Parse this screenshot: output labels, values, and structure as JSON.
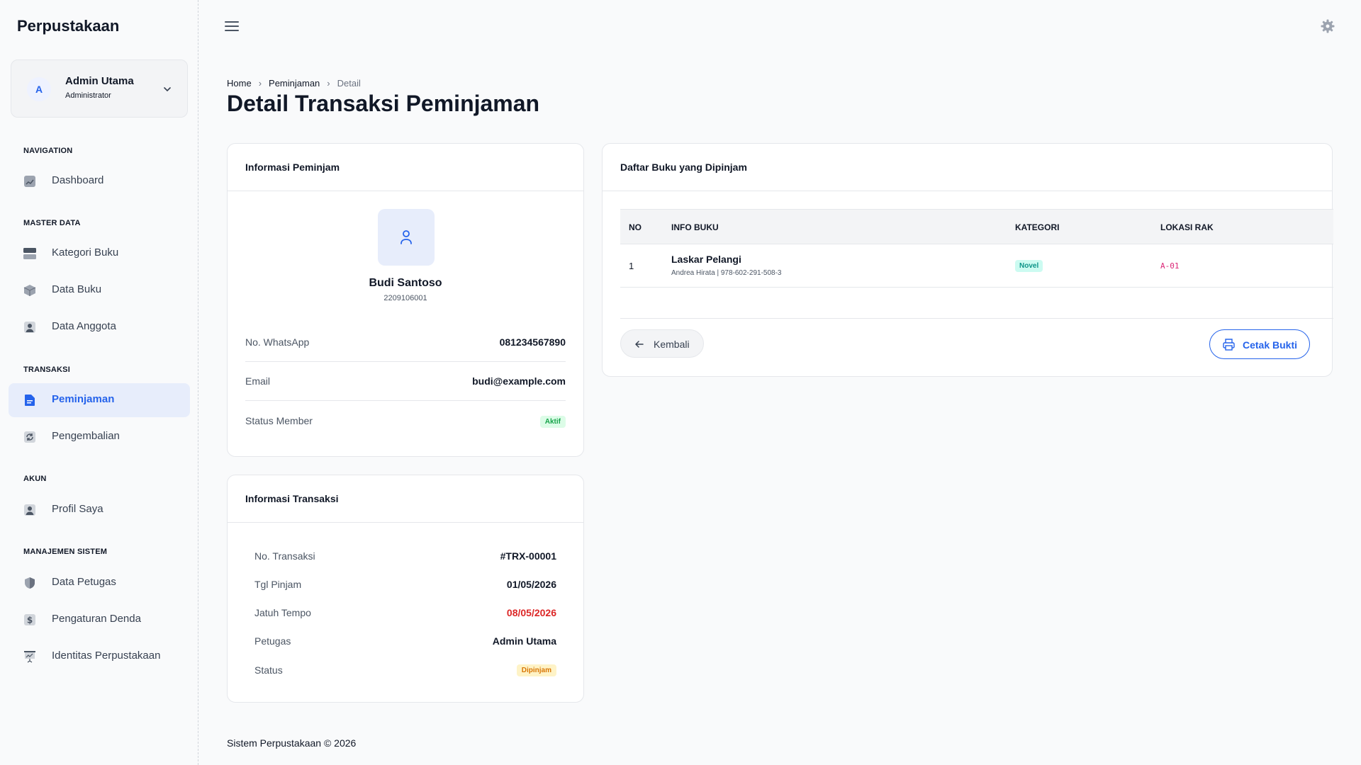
{
  "app": {
    "brand": "Perpustakaan"
  },
  "user": {
    "initial": "A",
    "name": "Admin Utama",
    "role": "Administrator"
  },
  "sidebar": {
    "sections": [
      {
        "title": "NAVIGATION"
      },
      {
        "title": "MASTER DATA"
      },
      {
        "title": "TRANSAKSI"
      },
      {
        "title": "AKUN"
      },
      {
        "title": "MANAJEMEN SISTEM"
      }
    ],
    "items": [
      {
        "label": "Dashboard",
        "icon": "chart-icon"
      },
      {
        "label": "Kategori Buku",
        "icon": "category-icon"
      },
      {
        "label": "Data Buku",
        "icon": "box-icon"
      },
      {
        "label": "Data Anggota",
        "icon": "user-icon"
      },
      {
        "label": "Peminjaman",
        "icon": "document-icon",
        "active": true
      },
      {
        "label": "Pengembalian",
        "icon": "refresh-icon"
      },
      {
        "label": "Profil Saya",
        "icon": "user-icon"
      },
      {
        "label": "Data Petugas",
        "icon": "shield-icon"
      },
      {
        "label": "Pengaturan Denda",
        "icon": "dollar-icon"
      },
      {
        "label": "Identitas Perpustakaan",
        "icon": "presentation-icon"
      }
    ]
  },
  "breadcrumb": [
    "Home",
    "Peminjaman",
    "Detail"
  ],
  "page": {
    "title": "Detail Transaksi Peminjaman"
  },
  "borrower": {
    "card_title": "Informasi Peminjam",
    "name": "Budi Santoso",
    "id": "2209106001",
    "rows": [
      {
        "label": "No. WhatsApp",
        "value": "081234567890"
      },
      {
        "label": "Email",
        "value": "budi@example.com"
      },
      {
        "label": "Status Member",
        "value": "Aktif"
      }
    ]
  },
  "transaction": {
    "card_title": "Informasi Transaksi",
    "rows": [
      {
        "label": "No. Transaksi",
        "value": "#TRX-00001"
      },
      {
        "label": "Tgl Pinjam",
        "value": "01/05/2026"
      },
      {
        "label": "Jatuh Tempo",
        "value": "08/05/2026"
      },
      {
        "label": "Petugas",
        "value": "Admin Utama"
      },
      {
        "label": "Status",
        "value": "Dipinjam"
      }
    ]
  },
  "books": {
    "card_title": "Daftar Buku yang Dipinjam",
    "columns": [
      "NO",
      "INFO BUKU",
      "KATEGORI",
      "LOKASI RAK"
    ],
    "rows": [
      {
        "no": "1",
        "title": "Laskar Pelangi",
        "meta": "Andrea Hirata | 978-602-291-508-3",
        "category": "Novel",
        "rack": "A-01"
      }
    ],
    "back_label": "Kembali",
    "print_label": "Cetak Bukti"
  },
  "footer": {
    "text": "Sistem Perpustakaan © 2026"
  },
  "colors": {
    "accent": "#2563eb",
    "danger": "#dc2626",
    "success": "#16a34a",
    "warning": "#d97706"
  }
}
